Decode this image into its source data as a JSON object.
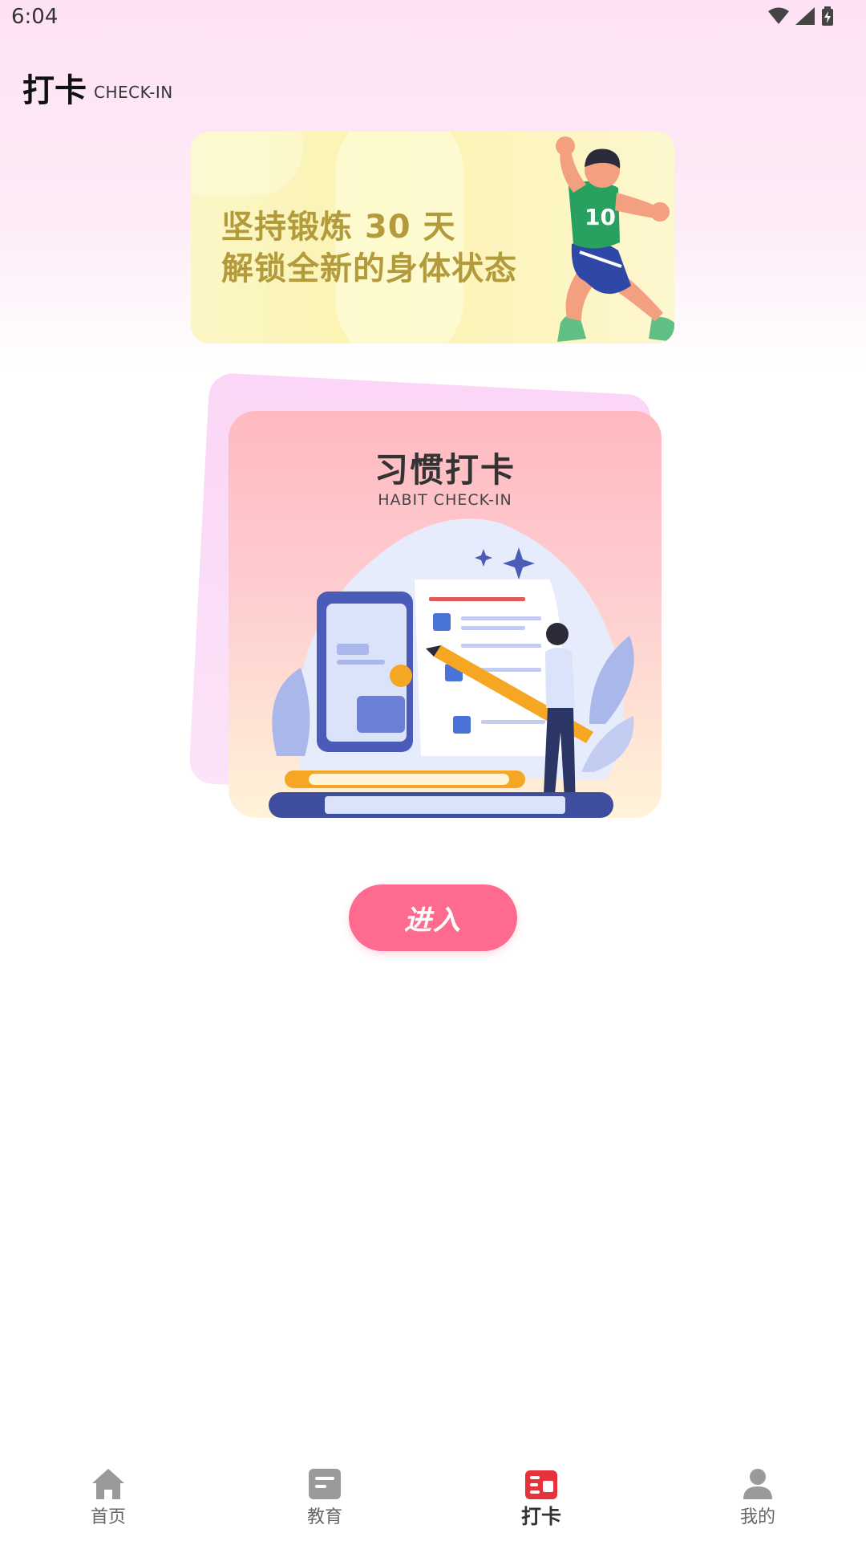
{
  "status_bar": {
    "time": "6:04"
  },
  "header": {
    "title": "打卡",
    "subtitle": "CHECK-IN"
  },
  "banner": {
    "line1": "坚持锻炼 30 天",
    "line2": "解锁全新的身体状态"
  },
  "habit_card": {
    "title": "习惯打卡",
    "subtitle": "HABIT CHECK-IN"
  },
  "enter_button": {
    "label": "进入"
  },
  "bottom_nav": {
    "items": [
      {
        "label": "首页",
        "icon": "home-icon",
        "active": false
      },
      {
        "label": "教育",
        "icon": "education-icon",
        "active": false
      },
      {
        "label": "打卡",
        "icon": "checkin-icon",
        "active": true
      },
      {
        "label": "我的",
        "icon": "profile-icon",
        "active": false
      }
    ]
  },
  "colors": {
    "accent": "#ff6b8f",
    "active_nav": "#e5323b",
    "inactive_nav": "#9a9a9a"
  }
}
